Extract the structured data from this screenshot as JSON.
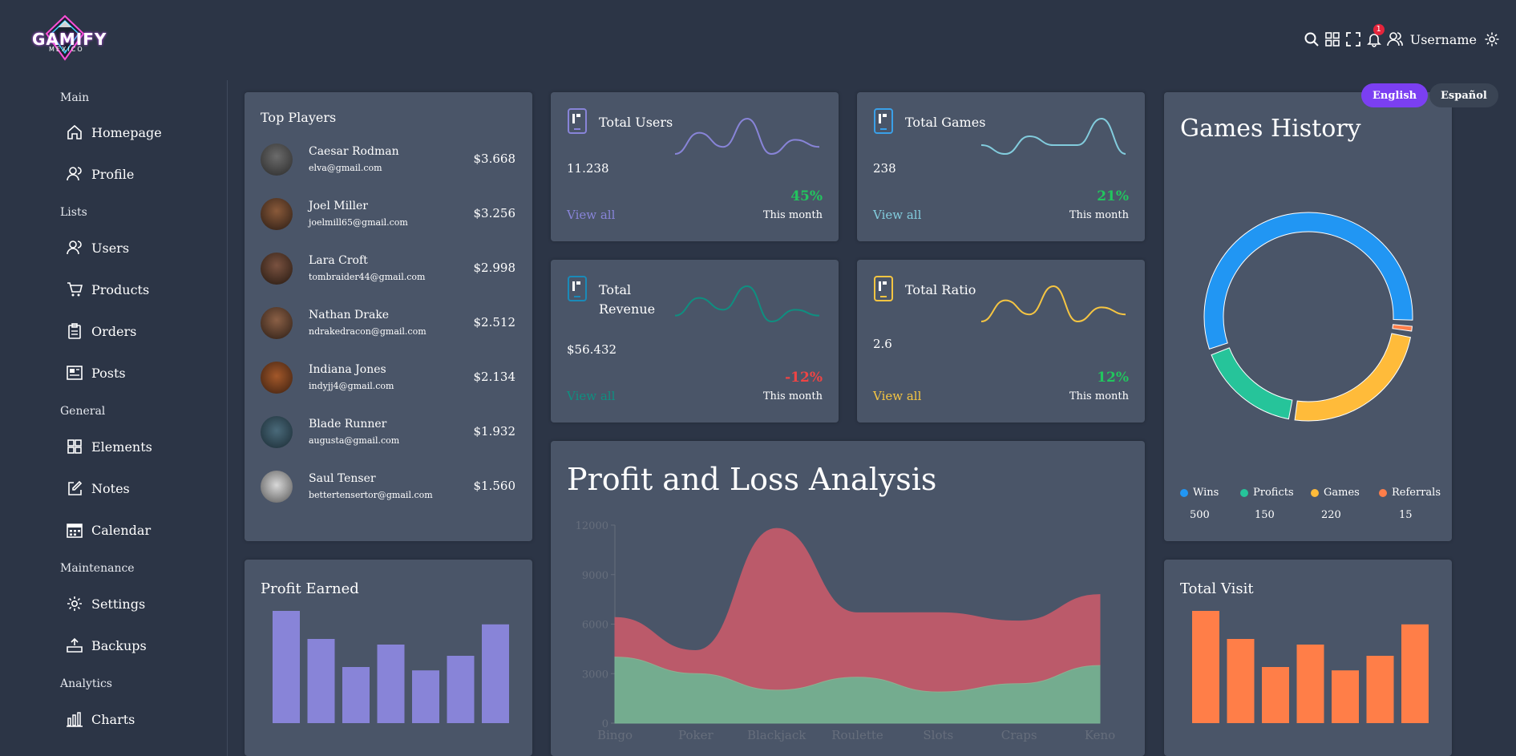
{
  "brand": {
    "name": "GAMIFY",
    "sub": "MEXICO",
    "accent": "#d14cff"
  },
  "header": {
    "icons": [
      "search-icon",
      "grid-icon",
      "fullscreen-icon",
      "bell-icon",
      "user-icon",
      "gear-icon"
    ],
    "notification_count": "1",
    "username": "Username"
  },
  "language": {
    "english": "English",
    "spanish": "Español",
    "active": "English"
  },
  "sidebar": {
    "sections": [
      {
        "title": "Main",
        "items": [
          {
            "label": "Homepage",
            "icon": "home-icon"
          },
          {
            "label": "Profile",
            "icon": "user-icon"
          }
        ]
      },
      {
        "title": "Lists",
        "items": [
          {
            "label": "Users",
            "icon": "users-icon"
          },
          {
            "label": "Products",
            "icon": "cart-icon"
          },
          {
            "label": "Orders",
            "icon": "clipboard-icon"
          },
          {
            "label": "Posts",
            "icon": "newspaper-icon"
          }
        ]
      },
      {
        "title": "General",
        "items": [
          {
            "label": "Elements",
            "icon": "elements-icon"
          },
          {
            "label": "Notes",
            "icon": "note-icon"
          },
          {
            "label": "Calendar",
            "icon": "calendar-icon"
          }
        ]
      },
      {
        "title": "Maintenance",
        "items": [
          {
            "label": "Settings",
            "icon": "gear-icon"
          },
          {
            "label": "Backups",
            "icon": "backup-icon"
          }
        ]
      },
      {
        "title": "Analytics",
        "items": [
          {
            "label": "Charts",
            "icon": "chart-icon"
          }
        ]
      }
    ]
  },
  "top_players": {
    "title": "Top Players",
    "players": [
      {
        "name": "Caesar Rodman",
        "email": "elva@gmail.com",
        "amount": "$3.668"
      },
      {
        "name": "Joel Miller",
        "email": "joelmill65@gmail.com",
        "amount": "$3.256"
      },
      {
        "name": "Lara Croft",
        "email": "tombraider44@gmail.com",
        "amount": "$2.998"
      },
      {
        "name": "Nathan Drake",
        "email": "ndrakedracon@gmail.com",
        "amount": "$2.512"
      },
      {
        "name": "Indiana Jones",
        "email": "indyjj4@gmail.com",
        "amount": "$2.134"
      },
      {
        "name": "Blade Runner",
        "email": "augusta@gmail.com",
        "amount": "$1.932"
      },
      {
        "name": "Saul Tenser",
        "email": "bettertensertor@gmail.com",
        "amount": "$1.560"
      }
    ]
  },
  "stats": [
    {
      "title": "Total Users",
      "value": "11.238",
      "link": "View all",
      "percent": "45%",
      "period": "This month",
      "color": "#8884d8",
      "pct_color": "#22c55e",
      "spark": [
        3,
        6,
        4,
        8,
        3,
        5,
        4
      ]
    },
    {
      "title": "Total Games",
      "value": "238",
      "link": "View all",
      "percent": "21%",
      "period": "This month",
      "color": "#82ccdd",
      "pct_color": "#22c55e",
      "spark": [
        3,
        1,
        5,
        3,
        3,
        9,
        1
      ]
    },
    {
      "title": "Total Revenue",
      "value": "$56.432",
      "link": "View all",
      "percent": "-12%",
      "period": "This month",
      "color": "#0f8f80",
      "pct_color": "#ef4444",
      "spark": [
        4,
        7,
        5,
        9,
        3,
        5,
        4
      ]
    },
    {
      "title": "Total Ratio",
      "value": "2.6",
      "link": "View all",
      "percent": "12%",
      "period": "This month",
      "color": "#f5c542",
      "pct_color": "#22c55e",
      "spark": [
        3,
        6,
        4,
        8,
        3,
        5,
        4
      ]
    }
  ],
  "games_history": {
    "title": "Games History",
    "items": [
      {
        "label": "Wins",
        "value": "500",
        "color": "#2196f3"
      },
      {
        "label": "Proficts",
        "value": "150",
        "color": "#26c49a"
      },
      {
        "label": "Games",
        "value": "220",
        "color": "#ffbb3a"
      },
      {
        "label": "Referrals",
        "value": "15",
        "color": "#ff7e4a"
      }
    ]
  },
  "profit_earned": {
    "title": "Profit Earned",
    "color": "#8884d8",
    "values": [
      100,
      75,
      50,
      70,
      47,
      60,
      88
    ]
  },
  "total_visit": {
    "title": "Total Visit",
    "color": "#ff7e48",
    "values": [
      100,
      75,
      50,
      70,
      47,
      60,
      88
    ]
  },
  "chart_data": {
    "type": "area",
    "title": "Profit and Loss Analysis",
    "categories": [
      "Bingo",
      "Poker",
      "Blackjack",
      "Roulette",
      "Slots",
      "Craps",
      "Keno"
    ],
    "ylim": [
      0,
      12000
    ],
    "yticks": [
      0,
      3000,
      6000,
      9000,
      12000
    ],
    "series": [
      {
        "values": [
          4000,
          3000,
          2000,
          2780,
          1890,
          2390,
          3490
        ],
        "color": "#82ca9d"
      },
      {
        "values": [
          2400,
          1398,
          9800,
          3908,
          4800,
          3800,
          4300
        ],
        "color": "#c25b6b"
      }
    ]
  }
}
